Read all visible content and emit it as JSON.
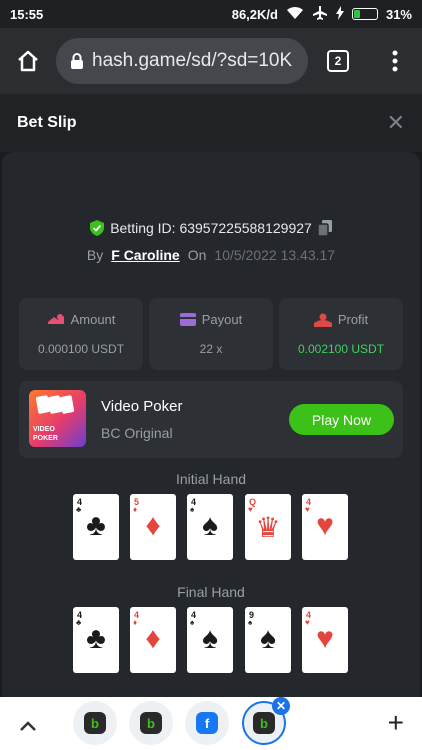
{
  "status": {
    "time": "15:55",
    "speed": "86,2K/d",
    "battery": "31%",
    "battery_level": 0.31,
    "icons": [
      "wifi-icon",
      "airplane-icon",
      "charging-icon",
      "battery-icon"
    ]
  },
  "browser": {
    "url": "hash.game/sd/?sd=10K",
    "tab_count": "2",
    "icons": [
      "home-icon",
      "lock-icon",
      "tabs-icon",
      "menu-icon"
    ]
  },
  "header": {
    "title": "Bet Slip",
    "close": "✕"
  },
  "bet": {
    "id_label": "Betting ID: 63957225588129927",
    "by_label": "By",
    "user": "F Caroline",
    "on_label": "On",
    "date": "10/5/2022 13.43.17"
  },
  "stats": [
    {
      "label": "Amount",
      "value": "0.000100 USDT",
      "icon": "coins-icon",
      "icon_color": "#e94f71"
    },
    {
      "label": "Payout",
      "value": "22 x",
      "icon": "wallet-icon",
      "icon_color": "#9b6bd8"
    },
    {
      "label": "Profit",
      "value": "0.002100 USDT",
      "icon": "profit-icon",
      "icon_color": "#e04848",
      "value_color": "#3ad35d"
    }
  ],
  "game": {
    "name": "Video Poker",
    "sub": "BC Original",
    "thumb_text_1": "VIDEO",
    "thumb_text_2": "POKER",
    "play_label": "Play Now"
  },
  "initial_hand": {
    "title": "Initial Hand",
    "cards": [
      {
        "rank": "4",
        "suit": "♣",
        "color": "black"
      },
      {
        "rank": "5",
        "suit": "♦",
        "color": "red"
      },
      {
        "rank": "4",
        "suit": "♠",
        "color": "black"
      },
      {
        "rank": "Q",
        "suit": "♥",
        "color": "red",
        "face": "♛"
      },
      {
        "rank": "4",
        "suit": "♥",
        "color": "red"
      }
    ]
  },
  "final_hand": {
    "title": "Final Hand",
    "cards": [
      {
        "rank": "4",
        "suit": "♣",
        "color": "black"
      },
      {
        "rank": "4",
        "suit": "♦",
        "color": "red"
      },
      {
        "rank": "4",
        "suit": "♠",
        "color": "black"
      },
      {
        "rank": "9",
        "suit": "♠",
        "color": "black"
      },
      {
        "rank": "4",
        "suit": "♥",
        "color": "red"
      }
    ]
  },
  "bottom": {
    "bubbles": [
      {
        "icon": "bc-game-icon",
        "glyph": "b",
        "bg": "#2a2a2a",
        "fg": "#3bc117"
      },
      {
        "icon": "bc-game-icon",
        "glyph": "b",
        "bg": "#2a2a2a",
        "fg": "#3bc117"
      },
      {
        "icon": "facebook-icon",
        "glyph": "f",
        "bg": "#1877f2",
        "fg": "#ffffff"
      },
      {
        "icon": "bc-game-icon",
        "glyph": "b",
        "bg": "#2a2a2a",
        "fg": "#3bc117",
        "active": true
      }
    ]
  }
}
